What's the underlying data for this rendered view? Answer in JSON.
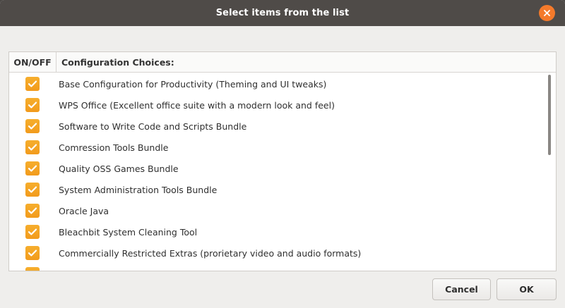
{
  "window": {
    "title": "Select items from the list"
  },
  "list": {
    "columns": [
      "ON/OFF",
      "Configuration Choices:"
    ],
    "items": [
      {
        "checked": true,
        "label": "Base Configuration for Productivity (Theming and UI tweaks)"
      },
      {
        "checked": true,
        "label": "WPS Office (Excellent office suite with a modern look and feel)"
      },
      {
        "checked": true,
        "label": "Software to Write Code and Scripts Bundle"
      },
      {
        "checked": true,
        "label": "Comression Tools Bundle"
      },
      {
        "checked": true,
        "label": "Quality OSS Games Bundle"
      },
      {
        "checked": true,
        "label": "System Administration Tools Bundle"
      },
      {
        "checked": true,
        "label": "Oracle Java"
      },
      {
        "checked": true,
        "label": "Bleachbit System Cleaning Tool"
      },
      {
        "checked": true,
        "label": "Commercially Restricted Extras (prorietary video and audio formats)"
      },
      {
        "checked": true,
        "label": "VLC Media Player"
      }
    ]
  },
  "buttons": {
    "cancel": "Cancel",
    "ok": "OK"
  },
  "colors": {
    "titlebar": "#4f4b48",
    "accent": "#f47a2b",
    "checkbox": "#f5a623"
  },
  "icons": {
    "close": "close-icon",
    "check": "checkmark-icon"
  }
}
